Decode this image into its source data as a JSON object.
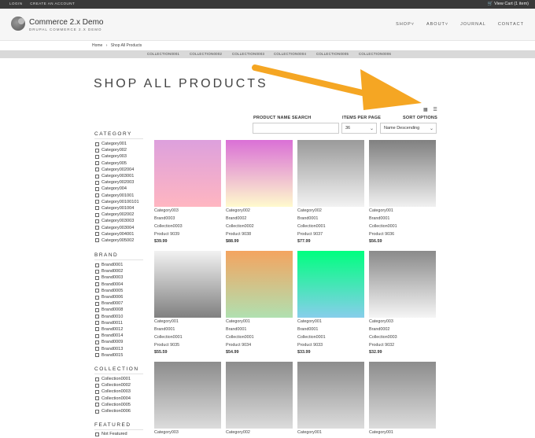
{
  "topbar": {
    "login": "LOGIN",
    "create_account": "CREATE AN ACCOUNT",
    "cart": "View Cart (1 item)"
  },
  "header": {
    "site_name": "Commerce 2.x Demo",
    "slogan": "DRUPAL COMMERCE 2.X DEMO",
    "nav": [
      "SHOP",
      "ABOUT",
      "JOURNAL",
      "CONTACT"
    ]
  },
  "breadcrumb": {
    "home": "Home",
    "separator": "›",
    "current": "Shop All Products"
  },
  "collections_bar": [
    "COLLECTION0001",
    "COLLECTION0002",
    "COLLECTION0003",
    "COLLECTION0004",
    "COLLECTION0005",
    "COLLECTION0006"
  ],
  "page_title": "SHOP ALL PRODUCTS",
  "annotation_color": "#f5a623",
  "filters": {
    "name_label": "PRODUCT NAME SEARCH",
    "name_value": "",
    "items_label": "ITEMS PER PAGE",
    "items_value": "36",
    "sort_label": "SORT OPTIONS",
    "sort_value": "Name Descending"
  },
  "sidebar": {
    "category": {
      "title": "CATEGORY",
      "items": [
        "Category001",
        "Category002",
        "Category003",
        "Category005",
        "Category002004",
        "Category003001",
        "Category002003",
        "Category004",
        "Category001001",
        "Category00100101",
        "Category001004",
        "Category002002",
        "Category003003",
        "Category003004",
        "Category004001",
        "Category005002"
      ]
    },
    "brand": {
      "title": "BRAND",
      "items": [
        "Brand0001",
        "Brand0002",
        "Brand0003",
        "Brand0004",
        "Brand0005",
        "Brand0006",
        "Brand0007",
        "Brand0008",
        "Brand0010",
        "Brand0011",
        "Brand0012",
        "Brand0014",
        "Brand0009",
        "Brand0013",
        "Brand0015"
      ]
    },
    "collection": {
      "title": "COLLECTION",
      "items": [
        "Collection0001",
        "Collection0002",
        "Collection0003",
        "Collection0004",
        "Collection0005",
        "Collection0006"
      ]
    },
    "featured": {
      "title": "FEATURED",
      "items": [
        "Not Featured"
      ]
    }
  },
  "products": [
    {
      "category": "Category003",
      "brand": "Brand0003",
      "collection": "Collection0003",
      "name": "Product 9039",
      "price": "$39.99",
      "gradient": [
        "#dda0dd",
        "#ffb6c1"
      ]
    },
    {
      "category": "Category002",
      "brand": "Brand0002",
      "collection": "Collection0002",
      "name": "Product 9038",
      "price": "$88.99",
      "gradient": [
        "#da70d6",
        "#fffacd"
      ]
    },
    {
      "category": "Category002",
      "brand": "Brand0001",
      "collection": "Collection0001",
      "name": "Product 9037",
      "price": "$77.99",
      "gradient": [
        "#9a9a9a",
        "#f2f2f2"
      ]
    },
    {
      "category": "Category001",
      "brand": "Brand0001",
      "collection": "Collection0001",
      "name": "Product 9036",
      "price": "$56.59",
      "gradient": [
        "#808080",
        "#f0f0f0"
      ]
    },
    {
      "category": "Category001",
      "brand": "Brand0001",
      "collection": "Collection0001",
      "name": "Product 9035",
      "price": "$55.59",
      "gradient": [
        "#f2f2f2",
        "#808080"
      ]
    },
    {
      "category": "Category001",
      "brand": "Brand0001",
      "collection": "Collection0001",
      "name": "Product 9034",
      "price": "$54.99",
      "gradient": [
        "#f4a460",
        "#b0e0b0"
      ]
    },
    {
      "category": "Category001",
      "brand": "Brand0001",
      "collection": "Collection0001",
      "name": "Product 9033",
      "price": "$33.99",
      "gradient": [
        "#00ff7f",
        "#87ceeb"
      ]
    },
    {
      "category": "Category003",
      "brand": "Brand0002",
      "collection": "Collection0003",
      "name": "Product 9032",
      "price": "$32.99",
      "gradient": [
        "#8a8a8a",
        "#f5f5f5"
      ]
    },
    {
      "category": "Category003",
      "brand": "",
      "collection": "",
      "name": "",
      "price": "",
      "gradient": [
        "#8c8c8c",
        "#dcdcdc"
      ]
    },
    {
      "category": "Category002",
      "brand": "",
      "collection": "",
      "name": "",
      "price": "",
      "gradient": [
        "#8c8c8c",
        "#dcdcdc"
      ]
    },
    {
      "category": "Category001",
      "brand": "",
      "collection": "",
      "name": "",
      "price": "",
      "gradient": [
        "#8c8c8c",
        "#dcdcdc"
      ]
    },
    {
      "category": "Category001",
      "brand": "",
      "collection": "",
      "name": "",
      "price": "",
      "gradient": [
        "#8c8c8c",
        "#dcdcdc"
      ]
    }
  ]
}
